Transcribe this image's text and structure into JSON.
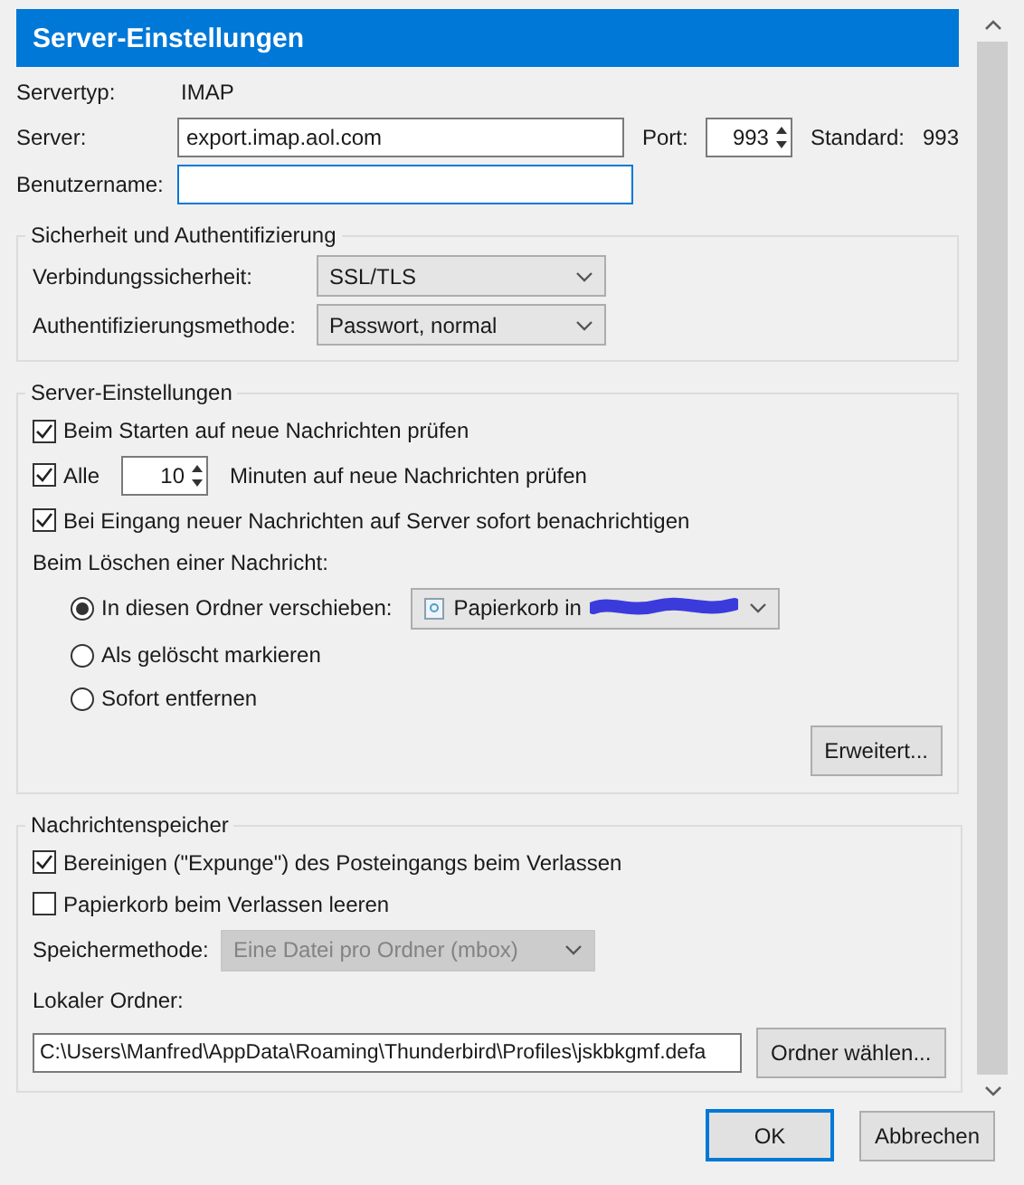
{
  "header": {
    "title": "Server-Einstellungen"
  },
  "server_info": {
    "type_label": "Servertyp:",
    "type_value": "IMAP",
    "server_label": "Server:",
    "server_value": "export.imap.aol.com",
    "port_label": "Port:",
    "port_value": "993",
    "default_label": "Standard:",
    "default_value": "993",
    "username_label": "Benutzername:",
    "username_focused": true
  },
  "security": {
    "legend": "Sicherheit und Authentifizierung",
    "fields": [
      {
        "label": "Verbindungssicherheit:",
        "value": "SSL/TLS"
      },
      {
        "label": "Authentifizierungsmethode:",
        "value": "Passwort, normal"
      }
    ]
  },
  "server_settings": {
    "legend": "Server-Einstellungen",
    "check_on_startup": {
      "label": "Beim Starten auf neue Nachrichten prüfen",
      "checked": true
    },
    "check_every": {
      "label": "Alle",
      "checked": true,
      "value": "10",
      "suffix": "Minuten auf neue Nachrichten prüfen"
    },
    "notify": {
      "label": "Bei Eingang neuer Nachrichten auf Server sofort benachrichtigen",
      "checked": true
    },
    "delete_label": "Beim Löschen einer Nachricht:",
    "delete_options": [
      {
        "kind": "folder",
        "label": "In diesen Ordner verschieben:",
        "selected": true,
        "folder": "Papierkorb in"
      },
      {
        "kind": "plain",
        "label": "Als gelöscht markieren",
        "selected": false
      },
      {
        "kind": "plain",
        "label": "Sofort entfernen",
        "selected": false
      }
    ],
    "advanced_button": "Erweitert..."
  },
  "storage": {
    "legend": "Nachrichtenspeicher",
    "checkboxes": [
      {
        "label": "Bereinigen (\"Expunge\") des Posteingangs beim Verlassen",
        "checked": true
      },
      {
        "label": "Papierkorb beim Verlassen leeren",
        "checked": false
      }
    ],
    "method": {
      "label": "Speichermethode:",
      "value": "Eine Datei pro Ordner (mbox)",
      "disabled": true
    },
    "local_folder": {
      "label": "Lokaler Ordner:",
      "value": "C:\\Users\\Manfred\\AppData\\Roaming\\Thunderbird\\Profiles\\jskbkgmf.defa",
      "button": "Ordner wählen..."
    }
  },
  "buttons": [
    {
      "label": "OK",
      "default": true
    },
    {
      "label": "Abbrechen",
      "default": false
    }
  ]
}
